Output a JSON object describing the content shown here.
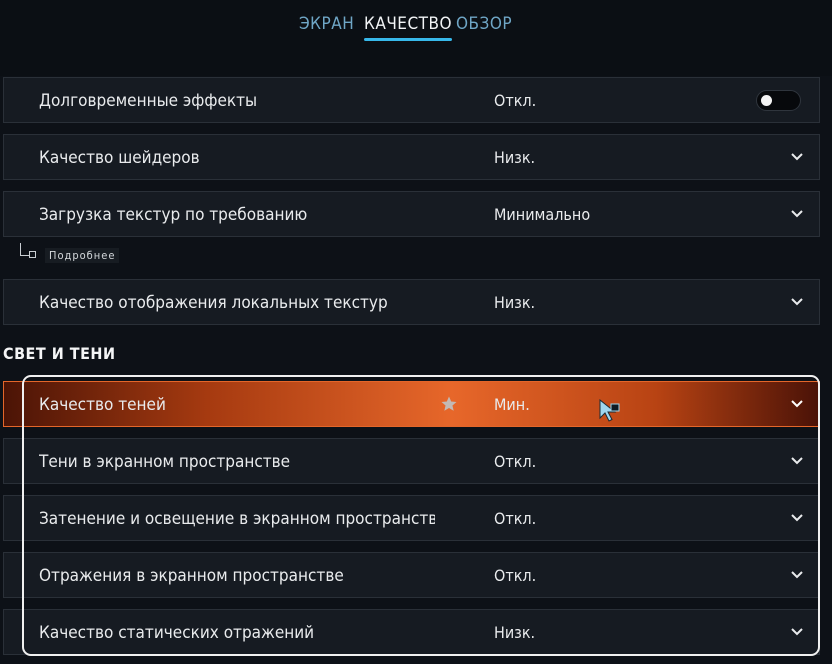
{
  "tabs": [
    {
      "label": "ЭКРАН",
      "active": false
    },
    {
      "label": "КАЧЕСТВО",
      "active": true
    },
    {
      "label": "ОБЗОР",
      "active": false
    }
  ],
  "settings": [
    {
      "label": "Долговременные эффекты",
      "value": "Откл.",
      "control": "toggle",
      "toggle_on": false
    },
    {
      "label": "Качество шейдеров",
      "value": "Низк.",
      "control": "dropdown"
    },
    {
      "label": "Загрузка текстур по требованию",
      "value": "Минимально",
      "control": "dropdown"
    },
    {
      "label": "Качество отображения локальных текстур",
      "value": "Низк.",
      "control": "dropdown"
    }
  ],
  "details_link": "Подробнее",
  "section_title": "СВЕТ И ТЕНИ",
  "lighting_settings": [
    {
      "label": "Качество теней",
      "value": "Мин.",
      "control": "dropdown",
      "highlighted": true,
      "starred": true
    },
    {
      "label": "Тени в экранном пространстве",
      "value": "Откл.",
      "control": "dropdown"
    },
    {
      "label": "Затенение и освещение в экранном пространстве",
      "value": "Откл.",
      "control": "dropdown"
    },
    {
      "label": "Отражения в экранном пространстве",
      "value": "Откл.",
      "control": "dropdown"
    },
    {
      "label": "Качество статических отражений",
      "value": "Низк.",
      "control": "dropdown"
    }
  ],
  "colors": {
    "accent": "#37b8ea",
    "highlight": "#e7672a",
    "background": "#0d1117",
    "row": "#161b22"
  },
  "icons": {
    "dropdown": "chevron-down-icon",
    "favorite": "star-icon",
    "cursor": "mouse-cursor-icon",
    "details": "sub-branch-icon"
  }
}
